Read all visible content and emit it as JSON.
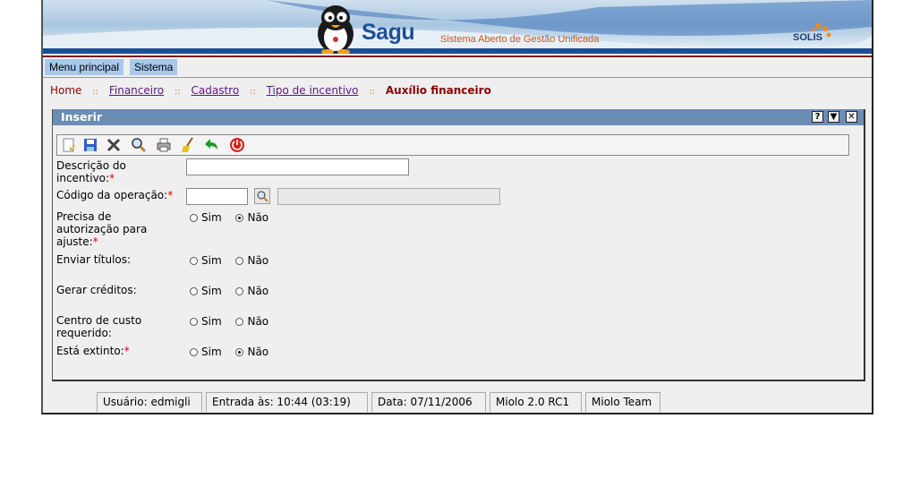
{
  "header": {
    "brand": "Sagu",
    "subtitle": "Sistema Aberto de Gestão Unificada",
    "partner_logo": "SOLIS"
  },
  "menu": {
    "items": [
      {
        "label": "Menu principal"
      },
      {
        "label": "Sistema"
      }
    ]
  },
  "breadcrumb": {
    "items": [
      "Home",
      "Financeiro",
      "Cadastro",
      "Tipo de incentivo"
    ],
    "separator": "::",
    "current": "Auxílio financeiro"
  },
  "panel": {
    "title": "Inserir",
    "buttons": {
      "help": "?",
      "minimize": "▼",
      "close": "✕"
    }
  },
  "toolbar": {
    "icons": [
      "new-icon",
      "save-icon",
      "delete-icon",
      "search-icon",
      "print-icon",
      "clear-icon",
      "back-icon",
      "exit-icon"
    ]
  },
  "form": {
    "fields": {
      "descricao": {
        "label": "Descrição do incentivo:",
        "required": "*",
        "value": ""
      },
      "codigo": {
        "label": "Código da operação:",
        "required": "*",
        "value": "",
        "description": ""
      },
      "autorizacao": {
        "label": "Precisa de autorização para ajuste:",
        "required": "*",
        "options": [
          "Sim",
          "Não"
        ],
        "selected": "Não"
      },
      "enviar": {
        "label": "Enviar títulos:",
        "options": [
          "Sim",
          "Não"
        ],
        "selected": ""
      },
      "gerar": {
        "label": "Gerar créditos:",
        "options": [
          "Sim",
          "Não"
        ],
        "selected": ""
      },
      "centro": {
        "label": "Centro de custo requerido:",
        "options": [
          "Sim",
          "Não"
        ],
        "selected": ""
      },
      "extinto": {
        "label": "Está extinto:",
        "required": "*",
        "options": [
          "Sim",
          "Não"
        ],
        "selected": "Não"
      }
    }
  },
  "status": {
    "user": "Usuário: edmigli",
    "login": "Entrada às: 10:44 (03:19)",
    "date": "Data: 07/11/2006",
    "version": "Miolo 2.0 RC1",
    "team": "Miolo Team"
  }
}
